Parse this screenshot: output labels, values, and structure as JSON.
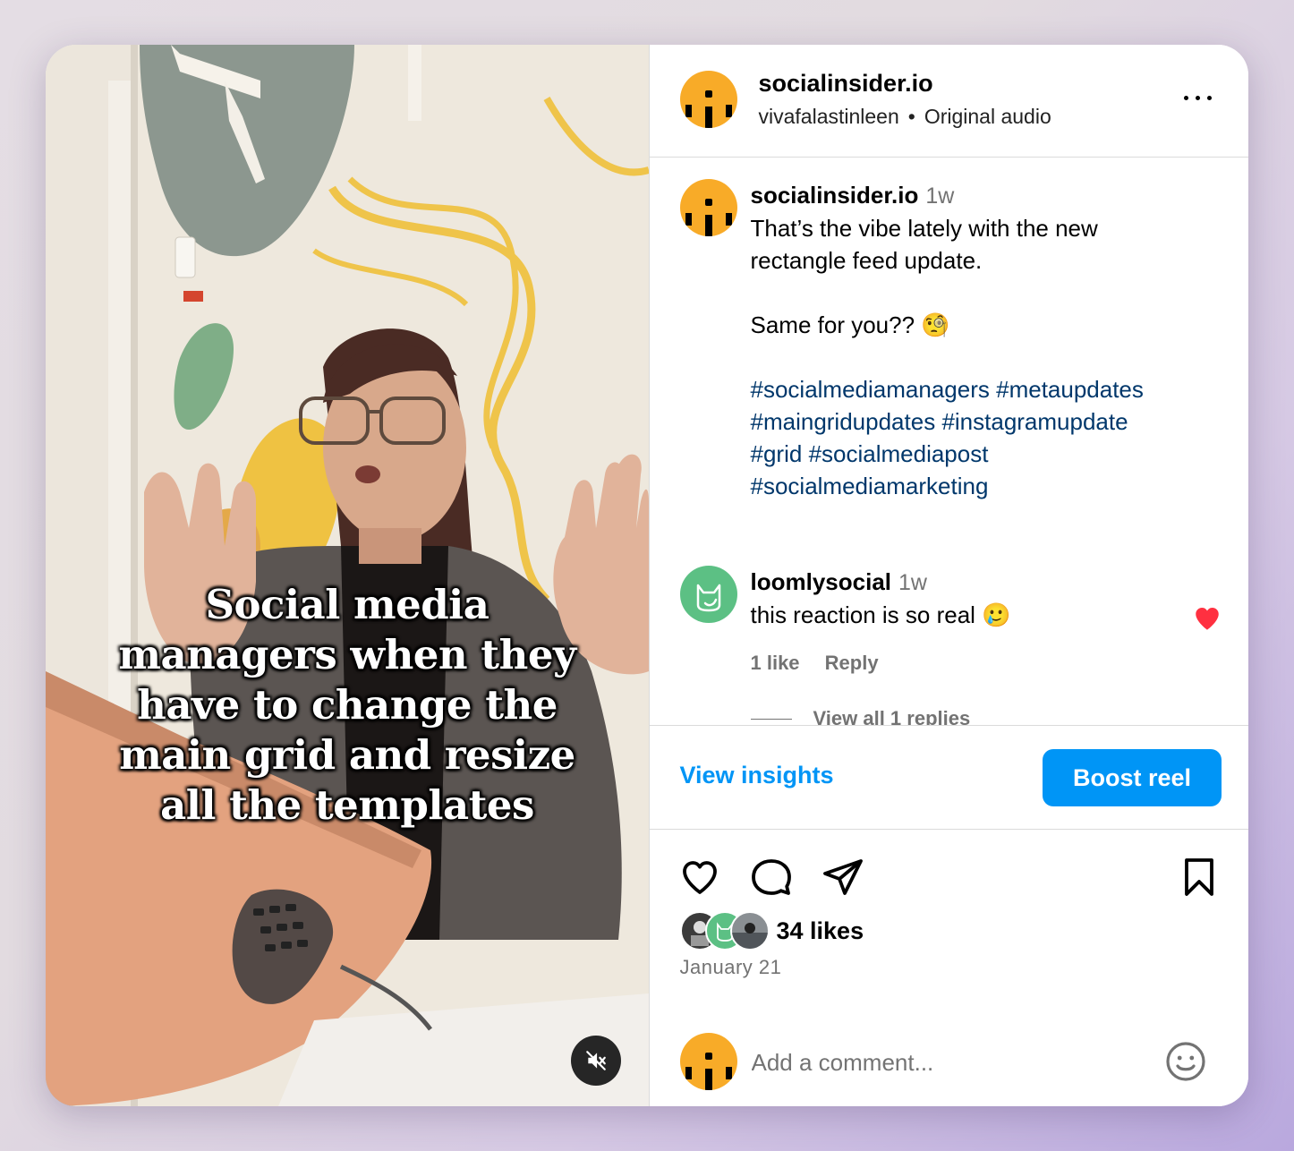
{
  "media": {
    "caption_lines": [
      "Social media",
      "managers when they",
      "have to change the",
      "main grid and resize",
      "all the templates"
    ],
    "mute_icon": "speaker-muted-icon"
  },
  "header": {
    "username": "socialinsider.io",
    "audio_author": "vivafalastinleen",
    "separator": "•",
    "audio_label": "Original audio",
    "more_icon": "more-horizontal-icon"
  },
  "post": {
    "username": "socialinsider.io",
    "time": "1w",
    "line1": "That’s the vibe lately with the new",
    "line2": "rectangle feed update.",
    "line3": "Same for you?? 🧐",
    "hashtags": [
      "#socialmediamanagers",
      "#metaupdates",
      "#maingridupdates",
      "#instagramupdate",
      "#grid",
      "#socialmediapost",
      "#socialmediamarketing"
    ]
  },
  "comment": {
    "username": "loomlysocial",
    "time": "1w",
    "text": "this reaction is so real 🥲",
    "likes": "1 like",
    "reply": "Reply",
    "view_replies": "View all 1 replies",
    "liked_color": "#ff3040"
  },
  "insights": {
    "view_label": "View insights",
    "boost_label": "Boost reel",
    "accent": "#0095f6"
  },
  "actions": {
    "icons": [
      "heart-outline-icon",
      "comment-bubble-icon",
      "share-send-icon",
      "bookmark-icon"
    ],
    "likes": "34 likes",
    "date": "January 21"
  },
  "add_comment": {
    "placeholder": "Add a comment...",
    "emoji_icon": "smiley-emoji-icon"
  }
}
